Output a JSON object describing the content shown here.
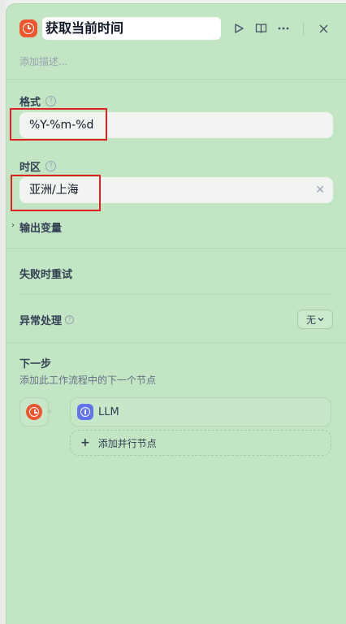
{
  "header": {
    "title": "获取当前时间",
    "description_placeholder": "添加描述..."
  },
  "fields": {
    "format": {
      "label": "格式",
      "value": "%Y-%m-%d"
    },
    "timezone": {
      "label": "时区",
      "value": "亚洲/上海"
    }
  },
  "sections": {
    "output_vars": "输出变量",
    "retry_on_fail": "失败时重试",
    "error_handling": {
      "label": "异常处理",
      "selected": "无"
    }
  },
  "next_step": {
    "title": "下一步",
    "description": "添加此工作流程中的下一个节点",
    "next_node": "LLM",
    "add_parallel": "添加并行节点"
  },
  "colors": {
    "panel_bg": "#c2e5c4",
    "node_icon": "#f2552c",
    "llm_icon": "#6172f3",
    "highlight_border": "#e0201f"
  }
}
